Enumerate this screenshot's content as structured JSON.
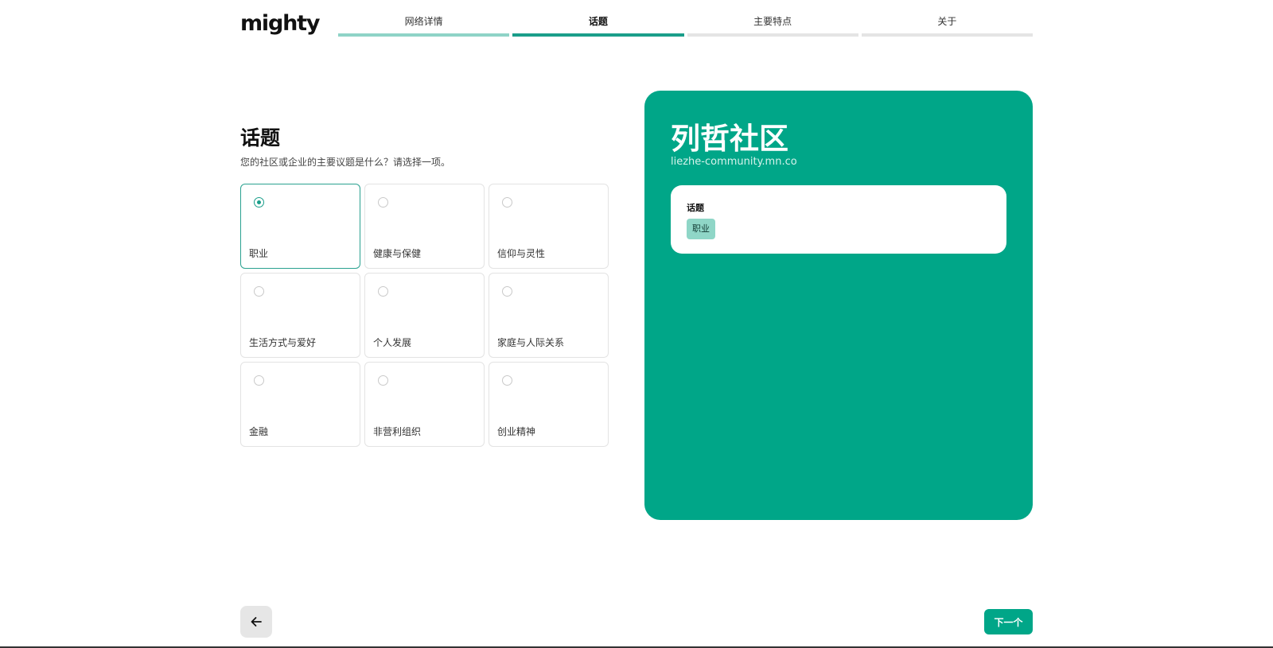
{
  "brand": {
    "logo_text": "mighty"
  },
  "steps": [
    {
      "label": "网络详情",
      "state": "done"
    },
    {
      "label": "话题",
      "state": "active"
    },
    {
      "label": "主要特点",
      "state": "pending"
    },
    {
      "label": "关于",
      "state": "pending"
    }
  ],
  "main": {
    "heading": "话题",
    "subtitle": "您的社区或企业的主要议题是什么？请选择一项。",
    "options": [
      {
        "label": "职业",
        "selected": true
      },
      {
        "label": "健康与保健",
        "selected": false
      },
      {
        "label": "信仰与灵性",
        "selected": false
      },
      {
        "label": "生活方式与爱好",
        "selected": false
      },
      {
        "label": "个人发展",
        "selected": false
      },
      {
        "label": "家庭与人际关系",
        "selected": false
      },
      {
        "label": "金融",
        "selected": false
      },
      {
        "label": "非营利组织",
        "selected": false
      },
      {
        "label": "创业精神",
        "selected": false
      }
    ]
  },
  "preview": {
    "community_name": "列哲社区",
    "url": "liezhe-community.mn.co",
    "topic_label": "话题",
    "topic_tag": "职业"
  },
  "footer": {
    "back_icon": "arrow-left-icon",
    "next_label": "下一个"
  },
  "colors": {
    "accent": "#00a688",
    "accent_light": "#8fd6c7",
    "step_done": "#8fd3c7",
    "step_active": "#1a9e8a"
  }
}
